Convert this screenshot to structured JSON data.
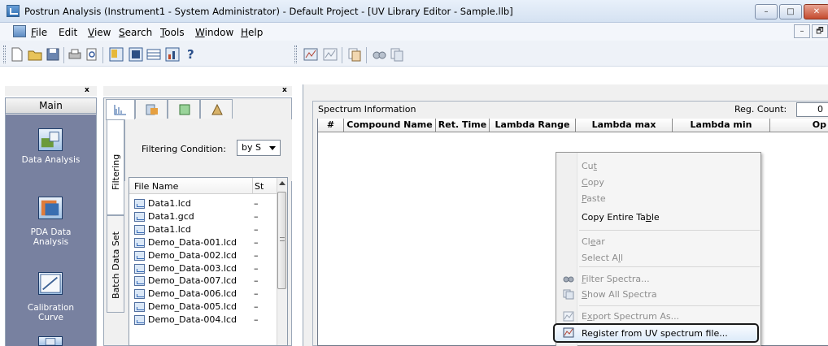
{
  "window": {
    "title": "Postrun Analysis (Instrument1 - System Administrator) - Default Project - [UV Library Editor - Sample.llb]",
    "controls": {
      "minimize": "–",
      "maximize": "□",
      "close": "✕"
    },
    "mdi_controls": {
      "minimize": "–",
      "restore": "🗗",
      "close": "✕"
    }
  },
  "menu": {
    "items": [
      {
        "label": "File",
        "accel": "F",
        "rest": "ile"
      },
      {
        "label": "Edit",
        "accel": "",
        "rest": "Edit"
      },
      {
        "label": "View",
        "accel": "V",
        "rest": "iew"
      },
      {
        "label": "Search",
        "accel": "S",
        "rest": "earch"
      },
      {
        "label": "Tools",
        "accel": "T",
        "rest": "ools"
      },
      {
        "label": "Window",
        "accel": "W",
        "rest": "indow"
      },
      {
        "label": "Help",
        "accel": "H",
        "rest": "elp"
      }
    ]
  },
  "toolbar": {
    "help_glyph": "?"
  },
  "left_nav": {
    "tab": "Main",
    "items": [
      {
        "label1": "Data Analysis",
        "label2": ""
      },
      {
        "label1": "PDA Data",
        "label2": "Analysis"
      },
      {
        "label1": "Calibration",
        "label2": "Curve"
      }
    ]
  },
  "panel_close": "x",
  "file_panel": {
    "vertical_tabs": [
      "Filtering",
      "Batch Data Set"
    ],
    "filter_label": "Filtering Condition:",
    "filter_value": "by S",
    "columns": [
      "File Name",
      "St"
    ],
    "files": [
      {
        "name": "Data1.lcd",
        "status": "–"
      },
      {
        "name": "Data1.gcd",
        "status": "–"
      },
      {
        "name": "Data1.lcd",
        "status": "–"
      },
      {
        "name": "Demo_Data-001.lcd",
        "status": "–"
      },
      {
        "name": "Demo_Data-002.lcd",
        "status": "–"
      },
      {
        "name": "Demo_Data-003.lcd",
        "status": "–"
      },
      {
        "name": "Demo_Data-007.lcd",
        "status": "–"
      },
      {
        "name": "Demo_Data-006.lcd",
        "status": "–"
      },
      {
        "name": "Demo_Data-005.lcd",
        "status": "–"
      },
      {
        "name": "Demo_Data-004.lcd",
        "status": "–"
      }
    ]
  },
  "spectrum": {
    "panel_title": "Spectrum Information",
    "reg_count_label": "Reg. Count:",
    "reg_count_value": "0",
    "columns": [
      "#",
      "Compound Name",
      "Ret. Time",
      "Lambda Range",
      "Lambda max",
      "Lambda min",
      "Op"
    ]
  },
  "context_menu": {
    "items": [
      {
        "pre": "Cu",
        "accel": "t",
        "post": "",
        "enabled": false
      },
      {
        "pre": "",
        "accel": "C",
        "post": "opy",
        "enabled": false
      },
      {
        "pre": "",
        "accel": "P",
        "post": "aste",
        "enabled": false
      },
      {
        "pre": "Copy Entire Ta",
        "accel": "b",
        "post": "le",
        "enabled": true
      },
      {
        "pre": "Cl",
        "accel": "e",
        "post": "ar",
        "enabled": false
      },
      {
        "pre": "Select A",
        "accel": "l",
        "post": "l",
        "enabled": false
      },
      {
        "pre": "",
        "accel": "F",
        "post": "ilter Spectra...",
        "enabled": false
      },
      {
        "pre": "",
        "accel": "S",
        "post": "how All Spectra",
        "enabled": false
      },
      {
        "pre": "E",
        "accel": "x",
        "post": "port Spectrum As...",
        "enabled": false
      },
      {
        "pre": "Register from UV spectrum file...",
        "accel": "",
        "post": "",
        "enabled": true
      }
    ]
  },
  "colors": {
    "nav_bg": "#7881a0",
    "title_bg": "#dbe6f4",
    "highlight_border": "#1a1a1a"
  }
}
